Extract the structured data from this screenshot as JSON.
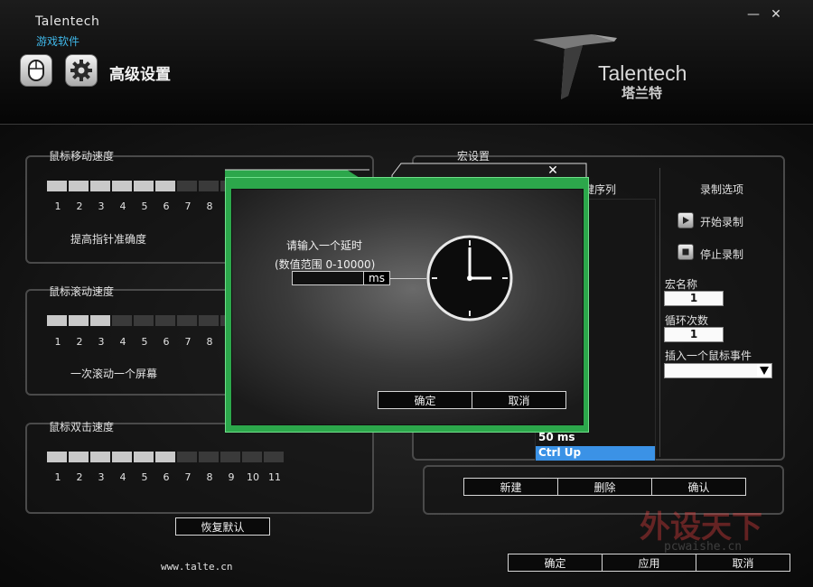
{
  "app": {
    "brand_name": "Talentech",
    "brand_sub": "游戏软件",
    "page_title": "高级设置",
    "logo_text": "Talentech",
    "logo_cn": "塔兰特",
    "window_controls": [
      "minimize",
      "close"
    ],
    "window_close_glyph": "✕",
    "window_min_glyph": "—"
  },
  "nav": [
    {
      "icon": "mouse-icon"
    },
    {
      "icon": "gear-icon"
    }
  ],
  "panels": {
    "move_speed": {
      "title": "鼠标移动速度",
      "value": 6,
      "ticks": [
        "1",
        "2",
        "3",
        "4",
        "5",
        "6",
        "7",
        "8"
      ],
      "note": "提高指针准确度"
    },
    "scroll_speed": {
      "title": "鼠标滚动速度",
      "value": 3,
      "ticks": [
        "1",
        "2",
        "3",
        "4",
        "5",
        "6",
        "7",
        "8"
      ],
      "note": "一次滚动一个屏幕"
    },
    "dblclick_speed": {
      "title": "鼠标双击速度",
      "value": 6,
      "ticks": [
        "1",
        "2",
        "3",
        "4",
        "5",
        "6",
        "7",
        "8",
        "9",
        "10",
        "11"
      ]
    },
    "restore_default": "恢复默认"
  },
  "macro": {
    "title": "宏设置",
    "key_sequence_label": "键序列",
    "record_options_title": "录制选项",
    "start_record": "开始录制",
    "stop_record": "停止录制",
    "macro_name_label": "宏名称",
    "macro_name_value": "1",
    "loop_count_label": "循环次数",
    "loop_count_value": "1",
    "insert_mouse_event_label": "插入一个鼠标事件",
    "list_items": [
      "50 ms",
      "Ctrl  Up"
    ],
    "buttons": [
      "新建",
      "删除",
      "确认"
    ]
  },
  "footer": {
    "url": "www.talte.cn",
    "buttons": [
      "确定",
      "应用",
      "取消"
    ]
  },
  "watermark": {
    "text": "外设天下",
    "url": "pcwaishe.cn"
  },
  "dialog": {
    "close_glyph": "✕",
    "prompt": "请输入一个延时",
    "range": "(数值范围 0-10000)",
    "input_value": "",
    "unit": "ms",
    "ok": "确定",
    "cancel": "取消"
  }
}
